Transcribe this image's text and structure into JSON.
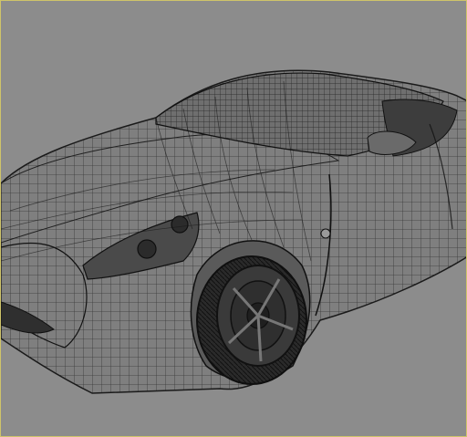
{
  "viewport": {
    "background": "#8c8c8c",
    "border_color": "#cfc46a"
  },
  "model": {
    "subject": "sports-car-wireframe",
    "shading": "flat-gray-with-edges",
    "body_color": "#7f7f7f",
    "edge_color": "#1f1f1f",
    "tire_color": "#2a2a2a",
    "rim_color": "#3a3a3a"
  }
}
